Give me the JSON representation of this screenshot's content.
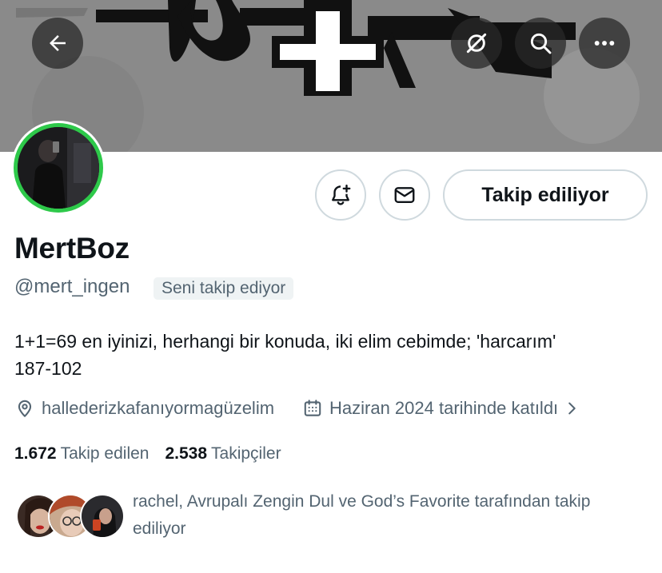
{
  "icons": {
    "back": "arrow-left-icon",
    "grok": "grok-icon",
    "search": "search-icon",
    "more": "more-icon",
    "notify": "bell-plus-icon",
    "message": "envelope-icon",
    "location": "location-pin-icon",
    "calendar": "calendar-icon",
    "chevron": "chevron-right-icon"
  },
  "colors": {
    "avatar_ring": "#2ec94a",
    "banner_bg": "#8c8c8c",
    "secondary_text": "#536471"
  },
  "profile": {
    "follow_button_label": "Takip ediliyor",
    "display_name": "MertBoz",
    "handle": "@mert_ingen",
    "follows_you_badge": "Seni takip ediyor",
    "bio_line1": "1+1=69 en iyinizi, herhangi bir konuda, iki elim cebimde; 'harcarım'",
    "bio_line2": "187-102",
    "location": "hallederizkafanıyormagüzelim",
    "joined": "Haziran 2024 tarihinde katıldı"
  },
  "stats": {
    "following_count": "1.672",
    "following_label": "Takip edilen",
    "followers_count": "2.538",
    "followers_label": "Takipçiler"
  },
  "followed_by": {
    "text": "rachel, Avrupalı Zengin Dul ve God’s Favorite tarafından takip ediliyor"
  }
}
